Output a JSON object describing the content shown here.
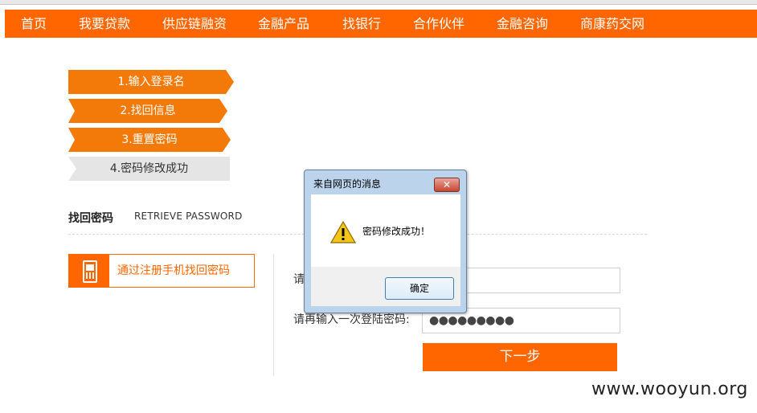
{
  "nav": {
    "items": [
      "首页",
      "我要贷款",
      "供应链融资",
      "金融产品",
      "找银行",
      "合作伙伴",
      "金融咨询",
      "商康药交网"
    ]
  },
  "steps": [
    "1.输入登录名",
    "2.找回信息",
    "3.重置密码",
    "4.密码修改成功"
  ],
  "section": {
    "title": "找回密码",
    "subtitle": "RETRIEVE PASSWORD"
  },
  "method": {
    "label": "通过注册手机找回密码",
    "icon": "mobile-phone-icon"
  },
  "form": {
    "label_new": "请",
    "label_confirm": "请再输入一次登陆密码:",
    "new_password_value": "●●●●",
    "confirm_password_value": "●●●●●●●●●",
    "submit_label": "下一步"
  },
  "dialog": {
    "title": "来自网页的消息",
    "close_label": "✕",
    "message": "密码修改成功！",
    "ok_label": "确定",
    "icon": "warning-icon"
  },
  "watermark": "www.wooyun.org",
  "colors": {
    "accent": "#ff6600",
    "step_active": "#f37a08",
    "step_inactive": "#e5e5e5"
  }
}
